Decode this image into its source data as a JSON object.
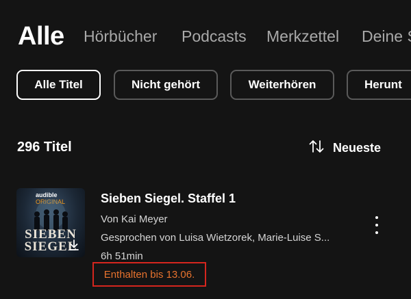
{
  "tabs": {
    "active": "Alle",
    "items": [
      "Hörbücher",
      "Podcasts",
      "Merkzettel",
      "Deine S"
    ]
  },
  "chips": [
    "Alle Titel",
    "Nicht gehört",
    "Weiterhören",
    "Herunt"
  ],
  "library": {
    "count": "296 Titel",
    "sort_label": "Neueste",
    "sort_icon": "sort-arrows-icon"
  },
  "item": {
    "cover": {
      "brand": "audible",
      "brand_suffix": "ORIGINAL",
      "title_line1": "SIEBEN",
      "title_line2": "SIEGEL",
      "download_icon": "download-icon"
    },
    "title": "Sieben Siegel. Staffel 1",
    "author": "Von Kai Meyer",
    "narrator": "Gesprochen von Luisa Wietzorek, Marie-Luise S...",
    "duration": "6h 51min",
    "expiry": "Enthalten bis 13.06.",
    "more_icon": "more-vertical-icon"
  },
  "colors": {
    "background": "#141414",
    "expiry_text": "#e8732e",
    "expiry_border": "#d6261e",
    "brand_accent": "#f39a1d"
  }
}
